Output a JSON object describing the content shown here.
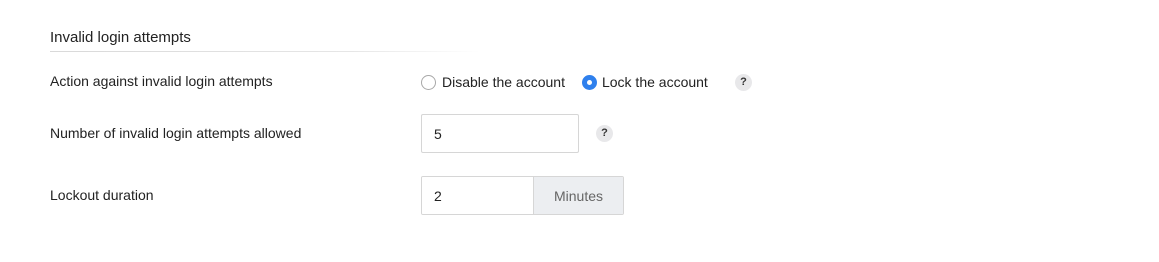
{
  "section": {
    "title": "Invalid login attempts"
  },
  "action": {
    "label": "Action against invalid login attempts",
    "options": [
      {
        "label": "Disable the account",
        "selected": false
      },
      {
        "label": "Lock the account",
        "selected": true
      }
    ],
    "help": "?"
  },
  "attempts": {
    "label": "Number of invalid login attempts allowed",
    "value": "5",
    "help": "?"
  },
  "lockout": {
    "label": "Lockout duration",
    "value": "2",
    "unit": "Minutes"
  },
  "colors": {
    "accent": "#2f80ed",
    "unit_background": "#eceef1",
    "input_border": "#d6d6d6"
  },
  "icons": {
    "radio_unselected": "radio-unchecked-icon",
    "radio_selected": "radio-checked-icon",
    "help": "question-mark-icon"
  }
}
